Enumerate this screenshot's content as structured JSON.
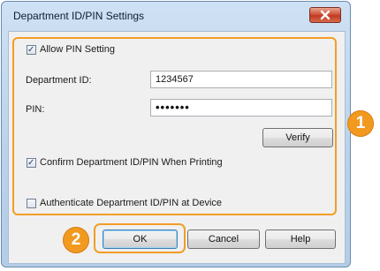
{
  "dialog": {
    "title": "Department ID/PIN Settings",
    "close_icon": "close-icon"
  },
  "settings": {
    "allow_pin": {
      "label": "Allow PIN Setting",
      "checked": true
    },
    "department_id": {
      "label": "Department ID:",
      "value": "1234567"
    },
    "pin": {
      "label": "PIN:",
      "value": "•••••••"
    },
    "verify_label": "Verify",
    "confirm_when_printing": {
      "label": "Confirm Department ID/PIN When Printing",
      "checked": true
    },
    "authenticate_at_device": {
      "label": "Authenticate Department ID/PIN at Device",
      "checked": false
    }
  },
  "buttons": {
    "ok": "OK",
    "cancel": "Cancel",
    "help": "Help"
  },
  "callouts": {
    "one": "1",
    "two": "2"
  },
  "colors": {
    "highlight": "#f39d26",
    "badge": "#f29a1f"
  }
}
